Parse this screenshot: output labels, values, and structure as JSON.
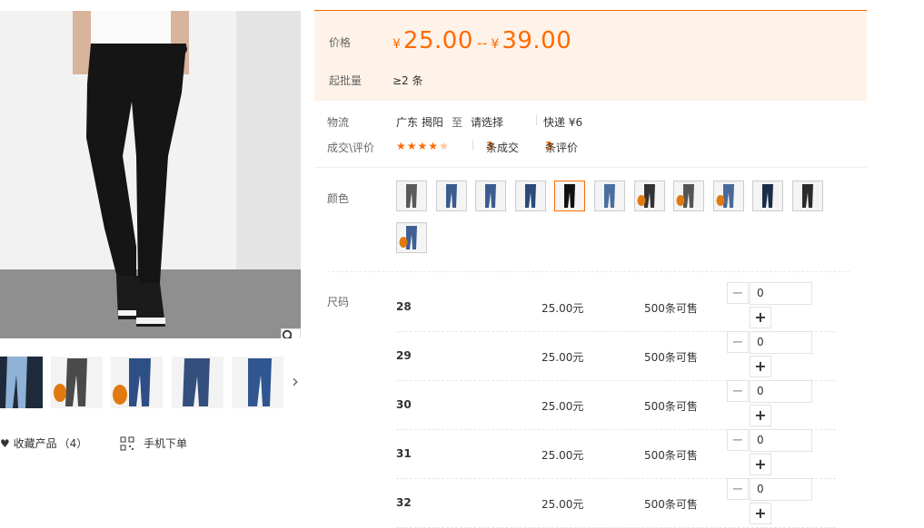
{
  "gallery": {
    "favorite_label": "收藏产品",
    "favorite_count": "（4）",
    "mobile_order_label": "手机下单",
    "thumbnails": [
      "light-blue-jeans",
      "dark-jeans-fleece",
      "blue-jeans-fleece",
      "blue-jeans",
      "blue-jeans-2"
    ]
  },
  "price": {
    "label": "价格",
    "currency": "¥",
    "min": "25.00",
    "separator": "--",
    "max": "39.00",
    "moq_label": "起批量",
    "moq_value": "≥2 条"
  },
  "shipping": {
    "label": "物流",
    "from": "广东 揭阳",
    "to_word": "至",
    "select_placeholder": "请选择",
    "express": "快递 ¥6"
  },
  "deals": {
    "label": "成交\\评价",
    "rating": 4.5,
    "deals_count": "3",
    "deals_text": "条成交",
    "reviews_count": "3",
    "reviews_text": "条评价"
  },
  "color": {
    "label": "颜色",
    "selected_index": 4,
    "swatches": [
      "grey",
      "blue",
      "blue",
      "blue-pose",
      "black",
      "blue-pose-2",
      "dark-fleece",
      "grey-fleece",
      "blue-fleece",
      "blue-dark",
      "black-grey",
      "blue-fleece-2"
    ]
  },
  "sizes": {
    "label": "尺码",
    "rows": [
      {
        "size": "28",
        "price": "25.00元",
        "stock": "500条可售",
        "qty": "0"
      },
      {
        "size": "29",
        "price": "25.00元",
        "stock": "500条可售",
        "qty": "0"
      },
      {
        "size": "30",
        "price": "25.00元",
        "stock": "500条可售",
        "qty": "0"
      },
      {
        "size": "31",
        "price": "25.00元",
        "stock": "500条可售",
        "qty": "0"
      },
      {
        "size": "32",
        "price": "25.00元",
        "stock": "500条可售",
        "qty": "0"
      }
    ]
  },
  "colors": {
    "accent": "#ff6a00",
    "panel_bg": "#fff2e8"
  }
}
